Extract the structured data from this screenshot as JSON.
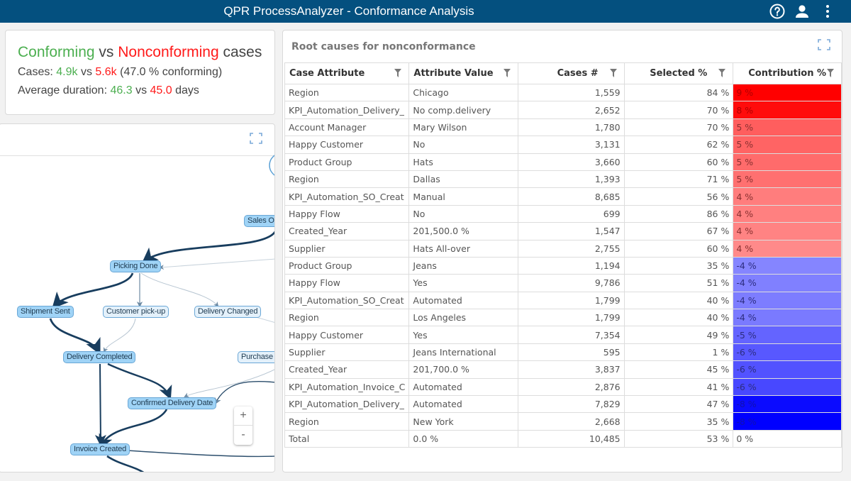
{
  "header": {
    "title": "QPR ProcessAnalyzer - Conformance Analysis",
    "icons": [
      "help-icon",
      "user-icon",
      "more-vertical-icon"
    ]
  },
  "kpi": {
    "title_conforming": "Conforming",
    "title_vs": "vs",
    "title_nonconforming": "Nonconforming",
    "title_suffix": "cases",
    "cases_label": "Cases:",
    "cases_conforming": "4.9k",
    "cases_vs": "vs",
    "cases_nonconforming": "5.6k",
    "cases_note": "(47.0 % conforming)",
    "duration_label": "Average duration:",
    "duration_conforming": "46.3",
    "duration_vs": "vs",
    "duration_nonconforming": "45.0",
    "duration_unit": "days",
    "colors": {
      "conforming": "#4caf50",
      "nonconforming": "#ff1a1a"
    }
  },
  "process_map": {
    "nodes": [
      {
        "label": "Sales Or",
        "style": "strong"
      },
      {
        "label": "Picking Done",
        "style": "strong"
      },
      {
        "label": "Shipment Sent",
        "style": "strong"
      },
      {
        "label": "Customer pick-up",
        "style": "light"
      },
      {
        "label": "Delivery Changed",
        "style": "light"
      },
      {
        "label": "Delivery Completed",
        "style": "strong"
      },
      {
        "label": "Purchase (",
        "style": "light"
      },
      {
        "label": "Confirmed Delivery Date",
        "style": "strong"
      },
      {
        "label": "Invoice Created",
        "style": "strong"
      }
    ],
    "zoom_in_label": "+",
    "zoom_out_label": "-"
  },
  "root_causes": {
    "title": "Root causes for nonconformance",
    "columns": [
      "Case Attribute",
      "Attribute Value",
      "Cases #",
      "Selected %",
      "Contribution %"
    ],
    "rows": [
      {
        "attribute": "Region",
        "value": "Chicago",
        "cases": "1,559",
        "selected": "84 %",
        "contribution": "9 %",
        "color": "#ff0000"
      },
      {
        "attribute": "KPI_Automation_Delivery_",
        "value": "No comp.delivery",
        "cases": "2,652",
        "selected": "70 %",
        "contribution": "8 %",
        "color": "#ff0c0c"
      },
      {
        "attribute": "Account Manager",
        "value": "Mary Wilson",
        "cases": "1,780",
        "selected": "70 %",
        "contribution": "5 %",
        "color": "#ff5e5e"
      },
      {
        "attribute": "Happy Customer",
        "value": "No",
        "cases": "3,131",
        "selected": "62 %",
        "contribution": "5 %",
        "color": "#ff6464"
      },
      {
        "attribute": "Product Group",
        "value": "Hats",
        "cases": "3,660",
        "selected": "60 %",
        "contribution": "5 %",
        "color": "#ff6b6b"
      },
      {
        "attribute": "Region",
        "value": "Dallas",
        "cases": "1,393",
        "selected": "71 %",
        "contribution": "5 %",
        "color": "#ff7070"
      },
      {
        "attribute": "KPI_Automation_SO_Creat",
        "value": "Manual",
        "cases": "8,685",
        "selected": "56 %",
        "contribution": "4 %",
        "color": "#ff7d7d"
      },
      {
        "attribute": "Happy Flow",
        "value": "No",
        "cases": "699",
        "selected": "86 %",
        "contribution": "4 %",
        "color": "#ff8080"
      },
      {
        "attribute": "Created_Year",
        "value": "201,500.0 %",
        "cases": "1,547",
        "selected": "67 %",
        "contribution": "4 %",
        "color": "#ff8383"
      },
      {
        "attribute": "Supplier",
        "value": "Hats All-over",
        "cases": "2,755",
        "selected": "60 %",
        "contribution": "4 %",
        "color": "#ff8a8a"
      },
      {
        "attribute": "Product Group",
        "value": "Jeans",
        "cases": "1,194",
        "selected": "35 %",
        "contribution": "-4 %",
        "color": "#8585ff"
      },
      {
        "attribute": "Happy Flow",
        "value": "Yes",
        "cases": "9,786",
        "selected": "51 %",
        "contribution": "-4 %",
        "color": "#8080ff"
      },
      {
        "attribute": "KPI_Automation_SO_Creat",
        "value": "Automated",
        "cases": "1,799",
        "selected": "40 %",
        "contribution": "-4 %",
        "color": "#7d7dff"
      },
      {
        "attribute": "Region",
        "value": "Los Angeles",
        "cases": "1,799",
        "selected": "40 %",
        "contribution": "-4 %",
        "color": "#7a7aff"
      },
      {
        "attribute": "Happy Customer",
        "value": "Yes",
        "cases": "7,354",
        "selected": "49 %",
        "contribution": "-5 %",
        "color": "#6464ff"
      },
      {
        "attribute": "Supplier",
        "value": "Jeans International",
        "cases": "595",
        "selected": "1 %",
        "contribution": "-6 %",
        "color": "#5858ff"
      },
      {
        "attribute": "Created_Year",
        "value": "201,700.0 %",
        "cases": "3,837",
        "selected": "45 %",
        "contribution": "-6 %",
        "color": "#5252ff"
      },
      {
        "attribute": "KPI_Automation_Invoice_C",
        "value": "Automated",
        "cases": "2,876",
        "selected": "41 %",
        "contribution": "-6 %",
        "color": "#4848ff"
      },
      {
        "attribute": "KPI_Automation_Delivery_",
        "value": "Automated",
        "cases": "7,829",
        "selected": "47 %",
        "contribution": "-8 %",
        "color": "#0b0bff"
      },
      {
        "attribute": "Region",
        "value": "New York",
        "cases": "2,668",
        "selected": "35 %",
        "contribution": "-8 %",
        "color": "#0000ff"
      },
      {
        "attribute": "Total",
        "value": "0.0 %",
        "cases": "10,485",
        "selected": "53 %",
        "contribution": "0 %",
        "color": "#ffffff"
      }
    ]
  }
}
